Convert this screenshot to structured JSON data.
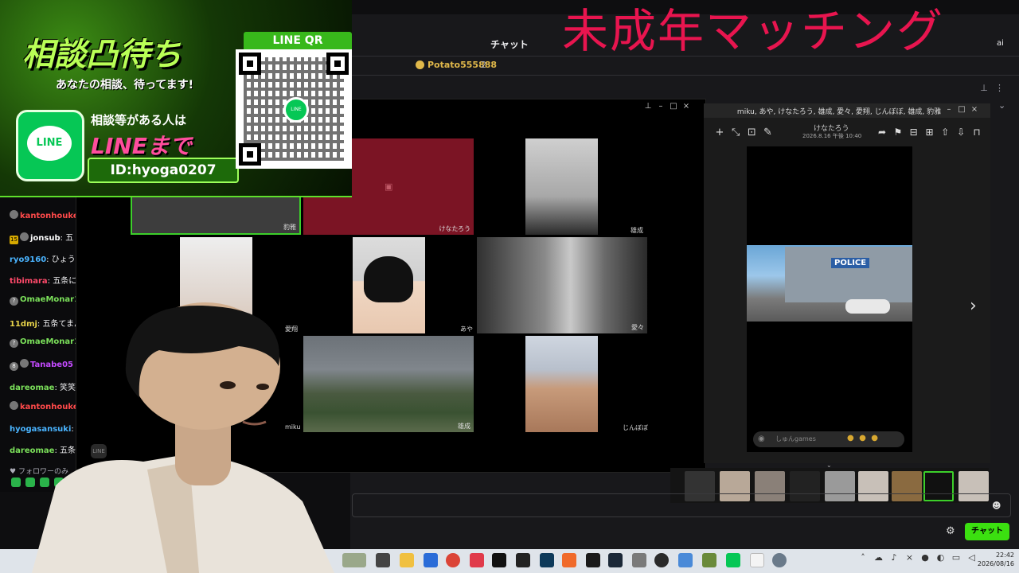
{
  "stream_title": "未成年マッチング",
  "chat_window": {
    "header_title": "チャット",
    "header_user": "ai",
    "pinned_user": "Potato555888",
    "pinned_count": "2",
    "send_button": "チャット"
  },
  "banner": {
    "title": "相談凸待ち",
    "subtitle": "あなたの相談、待ってます!",
    "line_logo": "LINE",
    "line1": "相談等がある人は",
    "line2": "LINEまで",
    "line_id": "ID:hyoga0207",
    "qr_label": "LINE QR",
    "qr_center": "LINE"
  },
  "left_chat": {
    "messages": [
      {
        "user": "kantonhoukei",
        "text": "",
        "color": "#ff4a4a"
      },
      {
        "user": "jonsub",
        "text": ": 五",
        "color": "#ffffff",
        "badge": "15"
      },
      {
        "user": "ryo9160",
        "text": ": ひょうが",
        "color": "#4ab4ff"
      },
      {
        "user": "tibimara",
        "text": ": 五条に手",
        "color": "#ff4a6a"
      },
      {
        "user": "OmaeMonar12",
        "text": "",
        "color": "#7be05a",
        "badge": "?"
      },
      {
        "user": "11dmj",
        "text": ": 五条てまん",
        "color": "#e8d44a"
      },
      {
        "user": "OmaeMonar12",
        "text": "",
        "color": "#7be05a",
        "badge": "?"
      },
      {
        "user": "Tanabe05",
        "text": "",
        "color": "#c44aff",
        "badge": "8"
      },
      {
        "user": "dareomae",
        "text": ": 笑笑",
        "color": "#7be05a"
      },
      {
        "user": "kantonhoukei",
        "text": "",
        "color": "#ff4a4a"
      },
      {
        "user": "hyogasansuki",
        "text": ": セ",
        "color": "#4ab4ff"
      },
      {
        "user": "dareomae",
        "text": ": 五条手",
        "color": "#7be05a"
      }
    ],
    "follower_only": "フォロワーのみ"
  },
  "call": {
    "participants": [
      "豹雅",
      "けなたろう",
      "雄成",
      "愛翔",
      "あや",
      "愛々",
      "miku",
      "雄成",
      "じんぼぼ"
    ]
  },
  "viewer": {
    "title": "miku, あや, けなたろう, 雄成, 愛々, 愛翔, じんぼぼ, 雄成, 豹雅",
    "user": "けなたろう",
    "date": "2026.8.16 午後 10:40",
    "sign": "POLICE",
    "input_placeholder": "しゅんgames"
  },
  "taskbar": {
    "time": "22:42",
    "date": "2026/08/16"
  }
}
